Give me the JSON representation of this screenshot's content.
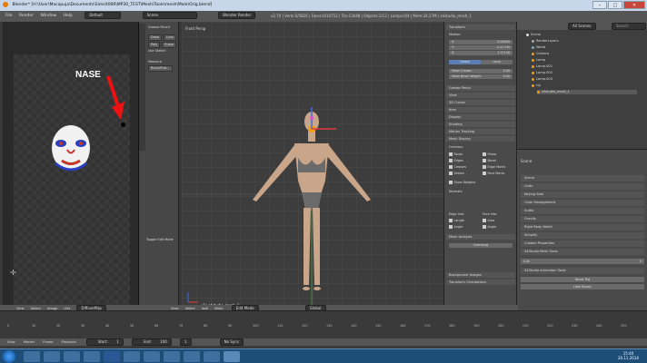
{
  "window": {
    "title": "Blender* [H:\\User\\Macapuja\\Documents\\SimsX006\\MP30_TEST\\Mesh\\Tools\\mesh\\Male\\Orig.blend]",
    "minimize": "–",
    "maximize": "□",
    "close": "✕"
  },
  "menubar": {
    "items": [
      "File",
      "Render",
      "Window",
      "Help"
    ],
    "layout_selector": "Default",
    "scene_selector": "Scene",
    "engine_selector": "Blender Render",
    "stats": "v2.70 | Verts:0/5826 | Faces:0/10752 | Tris:13448 | Objects:1/12 | Lamps:0/4 | Mem:34.27M | s4studio_mesh_1"
  },
  "image_editor": {
    "annotation_label": "NASE",
    "header_items": [
      "View",
      "Select",
      "Image",
      "UVs"
    ],
    "image_name": "DiffuseMap",
    "colors": {
      "arrow": "#ee1111",
      "label": "#ffffff"
    }
  },
  "tool_shelf": {
    "panel_title": "Grease Pencil",
    "buttons": [
      "Draw",
      "Line",
      "Poly",
      "Erase"
    ],
    "use_sketching": "Use Sketch",
    "measure_label": "Measure",
    "ruler_button": "Ruler/Prot...",
    "toggle_label": "Toggle Edit Mode"
  },
  "viewport": {
    "view_name": "Front Persp",
    "object_name": "(1) s4studio_mesh_1",
    "header_items": [
      "View",
      "Select",
      "Add",
      "Mesh"
    ],
    "mode": "Edit Mode",
    "orientation": "Global"
  },
  "n_panel": {
    "transform_header": "Transform",
    "median_label": "Median:",
    "fields": [
      {
        "label": "X:",
        "value": "0.00000"
      },
      {
        "label": "Y:",
        "value": "-0.11749"
      },
      {
        "label": "Z:",
        "value": "1.71140"
      }
    ],
    "global_btn": "Global",
    "local_btn": "Local",
    "crease_label": "Mean Crease:",
    "crease_value": "0.00",
    "bevel_label": "Mean Bevel Weight:",
    "bevel_value": "0.00",
    "headers": [
      "Grease Pencil",
      "View",
      "3D Cursor",
      "Item",
      "Display",
      "Shading",
      "Motion Tracking",
      "Mesh Display"
    ],
    "overlays_label": "Overlays:",
    "overlay_options": [
      "Faces",
      "Sharp",
      "Edges",
      "Bevel",
      "Creases",
      "Edge Marks",
      "Seams",
      "Face Marks"
    ],
    "show_weights": "Show Weights",
    "normals_label": "Normals:",
    "edge_info": "Edge Info:",
    "face_info": "Face Info:",
    "length": "Length",
    "area": "Area",
    "angle": "Angle",
    "angle2": "Angle",
    "mesh_analysis": "Mesh Analysis",
    "analysis_type": "Overhang",
    "background_images": "Background Images",
    "transform_orientations": "Transform Orientations"
  },
  "outliner": {
    "dropdown": "All Scenes",
    "search_placeholder": "Search",
    "items": [
      "Scene",
      "RenderLayers",
      "World",
      "Camera",
      "Lamp",
      "Lamp.001",
      "Lamp.002",
      "Lamp.003",
      "rig",
      "s4studio_mesh_1"
    ]
  },
  "properties": {
    "context": "Scene",
    "panels": [
      "Scene",
      "Units",
      "Keying Sets",
      "Color Management",
      "Audio",
      "Gravity",
      "Rigid Body World",
      "Simplify",
      "Custom Properties",
      "S4Studio Mesh Tools"
    ],
    "cut_label": "Cut:",
    "cut_value": "0",
    "animation_tools": "S4Studio Animation Tools",
    "reset_rig": "Reset Rig",
    "hide_bones": "Hide Bones"
  },
  "timeline": {
    "header_items": [
      "View",
      "Marker",
      "Frame",
      "Playback"
    ],
    "start_label": "Start:",
    "start_value": "1",
    "end_label": "End:",
    "end_value": "100",
    "current_frame": "1",
    "sync": "No Sync",
    "ticks": [
      "0",
      "10",
      "20",
      "30",
      "40",
      "50",
      "60",
      "70",
      "80",
      "90",
      "100",
      "110",
      "120",
      "130",
      "140",
      "150",
      "160",
      "170",
      "180",
      "190",
      "200",
      "210",
      "220",
      "230",
      "240",
      "250"
    ]
  },
  "taskbar": {
    "clock_time": "15:40",
    "clock_date": "20.11.2014"
  }
}
